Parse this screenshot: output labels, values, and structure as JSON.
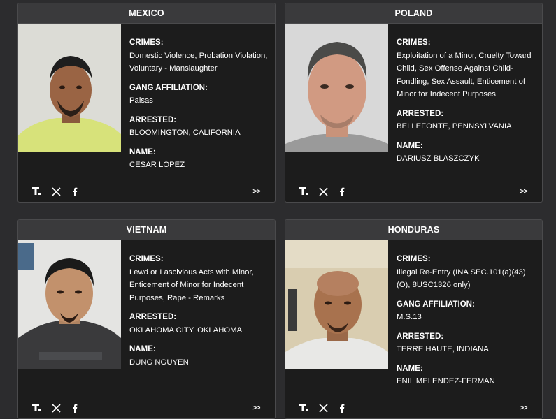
{
  "cards": [
    {
      "country": "MEXICO",
      "crimes_label": "CRIMES:",
      "crimes": "Domestic Violence, Probation Violation, Voluntary - Manslaughter",
      "gang_label": "GANG AFFILIATION:",
      "gang": "Paisas",
      "arrested_label": "ARRESTED:",
      "arrested": "BLOOMINGTON, CALIFORNIA",
      "name_label": "NAME:",
      "name": "CESAR LOPEZ",
      "more": ">>"
    },
    {
      "country": "POLAND",
      "crimes_label": "CRIMES:",
      "crimes": "Exploitation of a Minor, Cruelty Toward Child, Sex Offense Against Child-Fondling, Sex Assault, Enticement of Minor for Indecent Purposes",
      "arrested_label": "ARRESTED:",
      "arrested": "BELLEFONTE, PENNSYLVANIA",
      "name_label": "NAME:",
      "name": "DARIUSZ BLASZCZYK",
      "more": ">>"
    },
    {
      "country": "VIETNAM",
      "crimes_label": "CRIMES:",
      "crimes": "Lewd or Lascivious Acts with Minor, Enticement of Minor for Indecent Purposes, Rape - Remarks",
      "arrested_label": "ARRESTED:",
      "arrested": "OKLAHOMA CITY, OKLAHOMA",
      "name_label": "NAME:",
      "name": "DUNG NGUYEN",
      "more": ">>"
    },
    {
      "country": "HONDURAS",
      "crimes_label": "CRIMES:",
      "crimes": "Illegal Re-Entry (INA SEC.101(a)(43)(O), 8USC1326 only)",
      "gang_label": "GANG AFFILIATION:",
      "gang": "M.S.13",
      "arrested_label": "ARRESTED:",
      "arrested": "TERRE HAUTE, INDIANA",
      "name_label": "NAME:",
      "name": "ENIL MELENDEZ-FERMAN",
      "more": ">>"
    }
  ],
  "social_icons": [
    "truth-social-icon",
    "x-icon",
    "facebook-icon"
  ]
}
